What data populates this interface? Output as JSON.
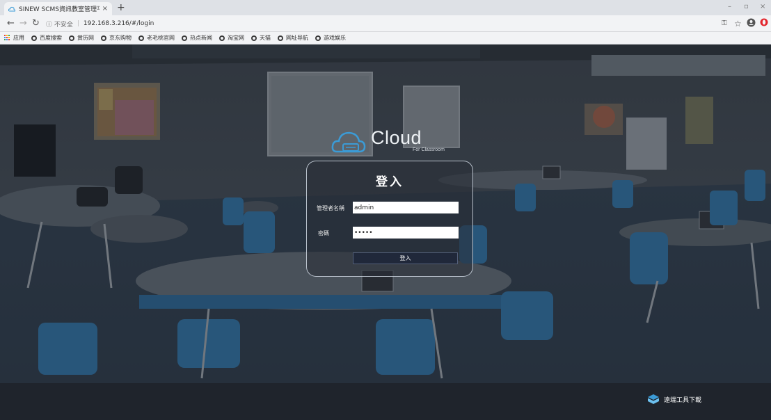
{
  "browser": {
    "tab_title": "SINEW SCMS資訊教室管理平台",
    "tab_close": "×",
    "new_tab": "+",
    "url_security": "ⓘ 不安全",
    "url": "192.168.3.216/#/login",
    "window_controls": {
      "minimize": "–",
      "maximize": "▫",
      "close": "×"
    },
    "bookmarks": [
      {
        "label": "应用"
      },
      {
        "label": "百度搜索"
      },
      {
        "label": "黄历网"
      },
      {
        "label": "京东购物"
      },
      {
        "label": "老毛桃官网"
      },
      {
        "label": "热点新闻"
      },
      {
        "label": "淘宝网"
      },
      {
        "label": "天猫"
      },
      {
        "label": "网址导航"
      },
      {
        "label": "游戏娱乐"
      }
    ]
  },
  "logo": {
    "brand": "Cloud",
    "subtitle": "For Classroom"
  },
  "login": {
    "title": "登入",
    "username_label": "管理者名稱",
    "username_value": "admin",
    "password_label": "密碼",
    "password_value": "admin",
    "submit_label": "登入"
  },
  "footer": {
    "download_label": "遠端工具下載"
  },
  "colors": {
    "accent": "#3b9bd6",
    "button": "#20283a"
  }
}
